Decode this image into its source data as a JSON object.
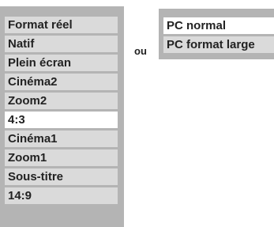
{
  "left_menu": {
    "items": [
      {
        "label": "Format réel",
        "selected": false
      },
      {
        "label": "Natif",
        "selected": false
      },
      {
        "label": "Plein écran",
        "selected": false
      },
      {
        "label": "Cinéma2",
        "selected": false
      },
      {
        "label": "Zoom2",
        "selected": false
      },
      {
        "label": "4:3",
        "selected": true
      },
      {
        "label": "Cinéma1",
        "selected": false
      },
      {
        "label": "Zoom1",
        "selected": false
      },
      {
        "label": "Sous-titre",
        "selected": false
      },
      {
        "label": "14:9",
        "selected": false
      }
    ]
  },
  "separator": {
    "label": "ou"
  },
  "right_menu": {
    "items": [
      {
        "label": "PC normal",
        "selected": true
      },
      {
        "label": "PC format large",
        "selected": false
      }
    ]
  },
  "colors": {
    "panel_bg": "#b4b4b4",
    "item_bg": "#dadada",
    "selected_bg": "#ffffff",
    "text": "#222222"
  }
}
